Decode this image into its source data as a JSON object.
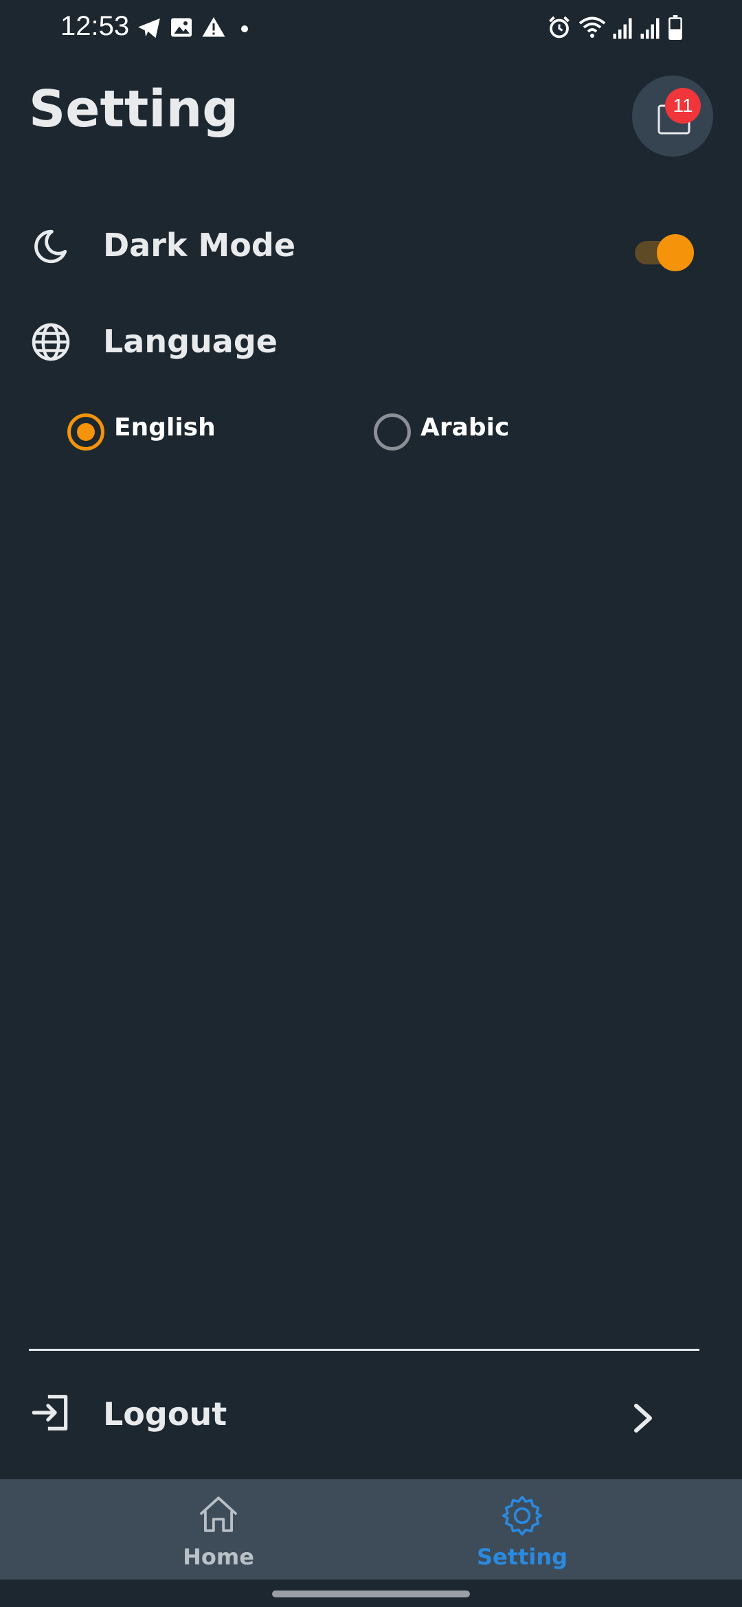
{
  "status_bar": {
    "time": "12:53",
    "left_icons": [
      "telegram-icon",
      "gallery-icon",
      "warning-icon",
      "dot-icon"
    ],
    "right_icons": [
      "alarm-icon",
      "wifi-icon",
      "signal-icon",
      "signal-icon",
      "battery-icon"
    ]
  },
  "header": {
    "title": "Setting",
    "notification_count": "11"
  },
  "settings": {
    "dark_mode": {
      "label": "Dark Mode",
      "enabled": true,
      "icon": "moon-icon"
    },
    "language": {
      "label": "Language",
      "icon": "globe-icon",
      "options": [
        {
          "label": "English",
          "selected": true
        },
        {
          "label": "Arabic",
          "selected": false
        }
      ]
    },
    "logout": {
      "label": "Logout",
      "icon": "logout-icon"
    }
  },
  "bottom_nav": {
    "items": [
      {
        "label": "Home",
        "icon": "home-icon",
        "active": false
      },
      {
        "label": "Setting",
        "icon": "gear-icon",
        "active": true
      }
    ]
  },
  "colors": {
    "background": "#1c2730",
    "accent": "#f5930a",
    "active_nav": "#2a8ae0",
    "badge": "#f0363a"
  }
}
